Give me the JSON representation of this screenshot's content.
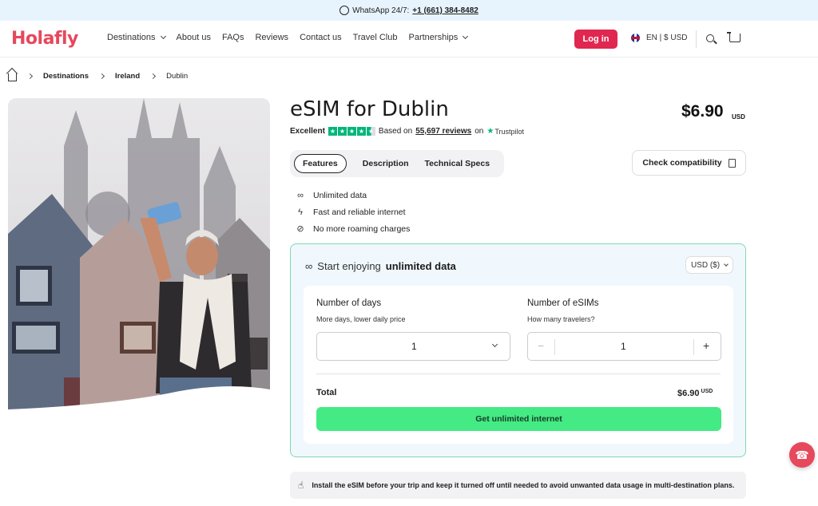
{
  "topbar": {
    "whatsapp_label": "WhatsApp 24/7:",
    "phone": "+1 (661) 384-8482"
  },
  "header": {
    "logo": "Holafly",
    "nav": [
      "Destinations",
      "About us",
      "FAQs",
      "Reviews",
      "Contact us",
      "Travel Club",
      "Partnerships"
    ],
    "login": "Log in",
    "language_currency": "EN | $ USD"
  },
  "breadcrumb": [
    "Destinations",
    "Ireland",
    "Dublin"
  ],
  "product": {
    "title": "eSIM for Dublin",
    "price": "$6.90",
    "price_currency": "USD",
    "rating_label": "Excellent",
    "based_on": "Based on",
    "review_count": "55,697 reviews",
    "on": "on",
    "platform": "Trustpilot"
  },
  "tabs": [
    "Features",
    "Description",
    "Technical Specs"
  ],
  "check_compatibility": "Check compatibility",
  "features": [
    {
      "icon": "infinity-icon",
      "text": "Unlimited data"
    },
    {
      "icon": "lightning-icon",
      "text": "Fast and reliable internet"
    },
    {
      "icon": "no-roaming-icon",
      "text": "No more roaming charges"
    }
  ],
  "plan": {
    "heading_prefix": "Start enjoying",
    "heading_bold": "unlimited data",
    "currency_select": "USD ($)",
    "days_label": "Number of days",
    "days_hint": "More days, lower daily price",
    "days_value": "1",
    "esims_label": "Number of eSIMs",
    "esims_hint": "How many travelers?",
    "esims_value": "1",
    "total_label": "Total",
    "total_value": "$6.90",
    "total_currency": "USD",
    "cta": "Get unlimited internet"
  },
  "notice": "Install the eSIM before your trip and keep it turned off until needed to avoid unwanted data usage in multi-destination plans.",
  "colors": {
    "brand": "#e6485c",
    "login": "#e0274f",
    "cta": "#44ea84",
    "trustpilot": "#00b67a",
    "card_border": "#7fd8b0"
  }
}
